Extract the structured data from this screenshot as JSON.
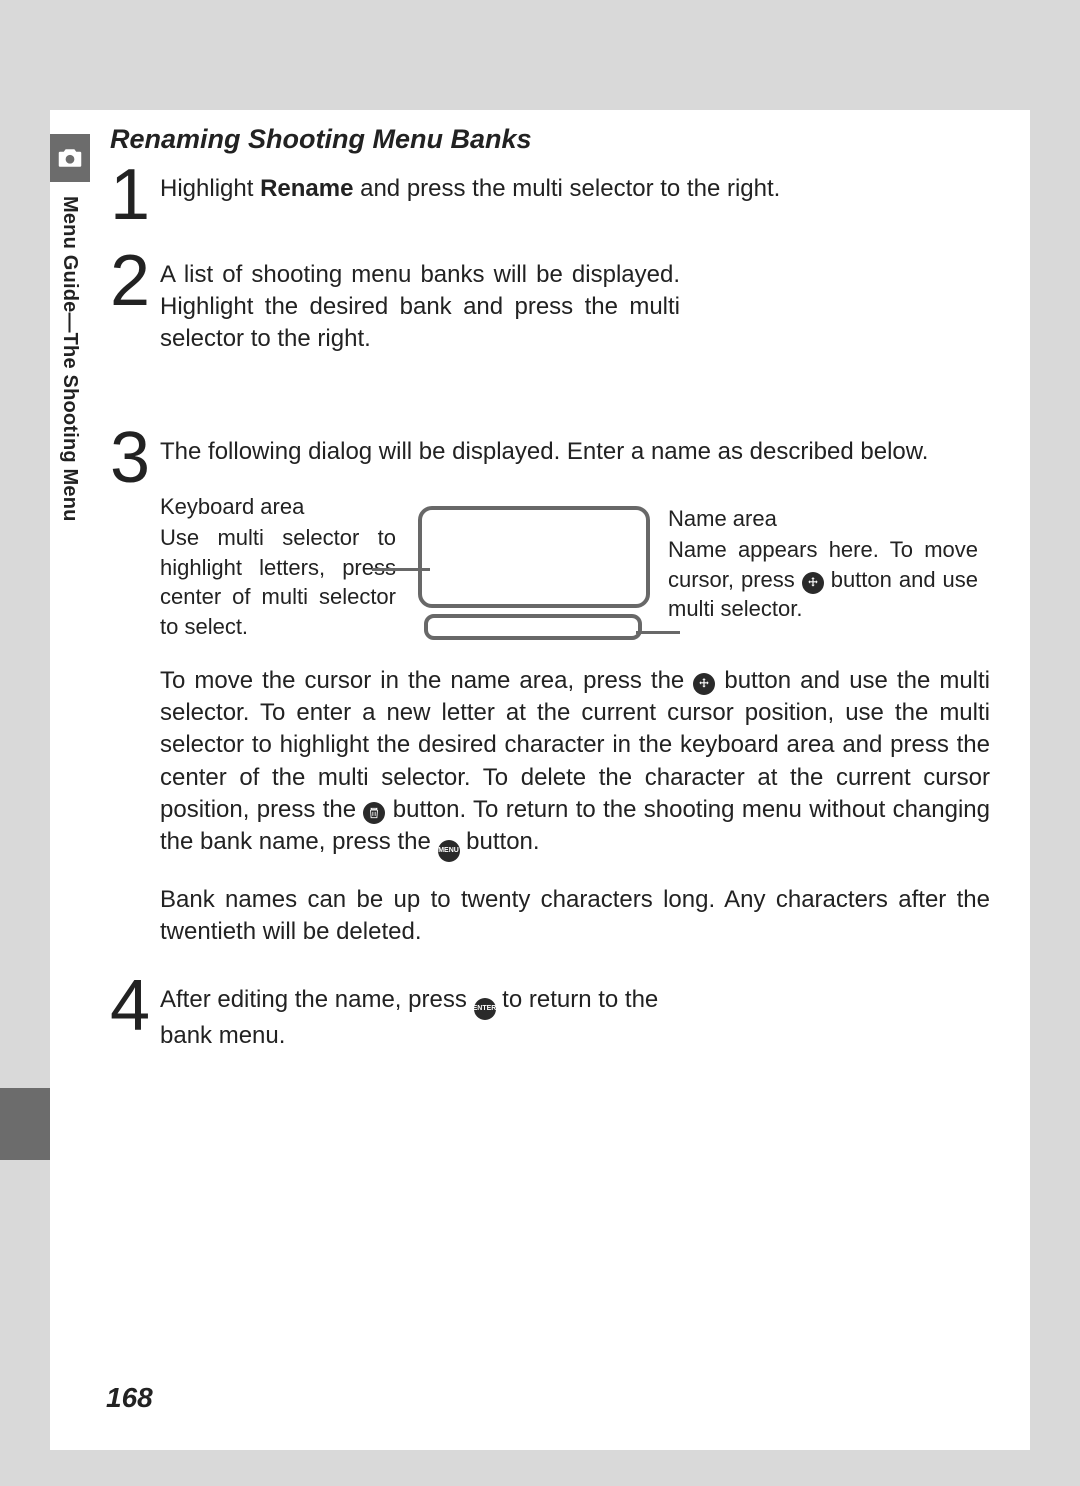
{
  "sidebar": {
    "icon_name": "camera-icon",
    "label": "Menu Guide—The Shooting Menu"
  },
  "section_title": "Renaming Shooting Menu Banks",
  "steps": {
    "s1": {
      "num": "1",
      "pre": "Highlight ",
      "bold": "Rename",
      "post": " and press the multi selector to the right."
    },
    "s2": {
      "num": "2",
      "text": "A list of shooting menu banks will be displayed. Highlight the desired bank and press the multi selector to the right."
    },
    "s3": {
      "num": "3",
      "intro": "The following dialog will be displayed.  Enter a name as described below.",
      "keyboard_title": "Keyboard area",
      "keyboard_text": "Use multi selector to highlight letters, press center of multi selector to select.",
      "name_title": "Name area",
      "name_text_pre": "Name appears here.  To move cursor, press ",
      "name_text_post": " button and use multi selector.",
      "para1_a": "To move the cursor in the name area, press the ",
      "para1_b": " button and use the multi selector.  To enter a new letter at the current cursor position, use the multi selector to highlight the desired character in the keyboard area and press the center of the multi selector.  To delete the character at the current cursor position, press the ",
      "para1_c": " button.  To return to the shooting menu without changing the bank name, press the ",
      "para1_d": " button.",
      "para2": "Bank names can be up to twenty characters long.  Any characters after the twentieth will be deleted."
    },
    "s4": {
      "num": "4",
      "pre": "After editing the name, press ",
      "post": " to return to the bank menu."
    }
  },
  "icons": {
    "move": "move-cursor-icon",
    "trash": "trash-icon",
    "menu": "MENU",
    "enter": "ENTER"
  },
  "page_number": "168"
}
